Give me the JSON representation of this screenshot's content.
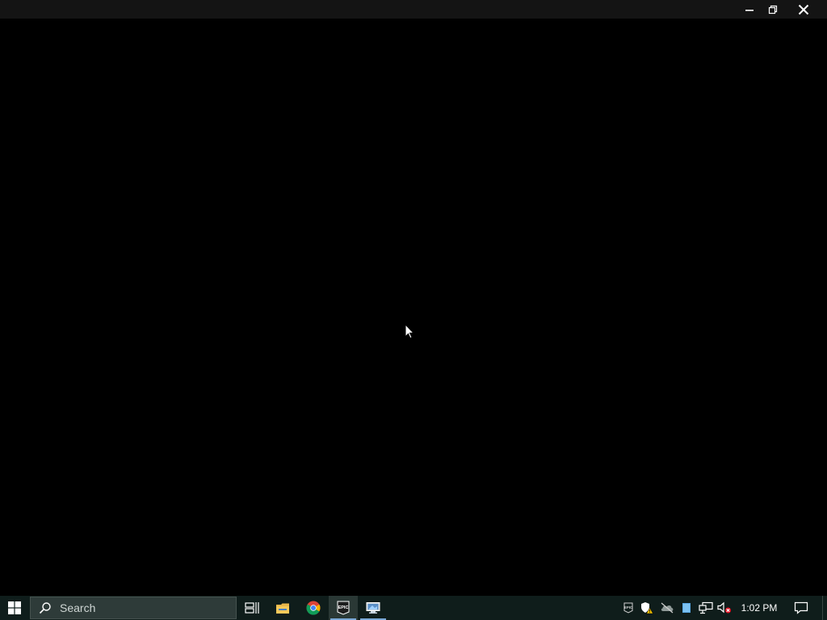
{
  "window": {
    "title": "",
    "buttons": [
      "minimize",
      "maximize",
      "close"
    ]
  },
  "taskbar": {
    "search_placeholder": "Search",
    "pinned_apps": [
      "task-view",
      "file-explorer",
      "google-chrome",
      "epic-games-launcher",
      "remote-desktop"
    ],
    "active_app": "epic-games-launcher",
    "tray_icons": [
      "epic-games-tray",
      "security-warning",
      "onedrive-offline",
      "notes",
      "network",
      "volume-muted"
    ],
    "clock": "1:02 PM"
  },
  "colors": {
    "background": "#000000",
    "titlebar": "#141414",
    "taskbar": "#0f1d1b",
    "search_box": "#2e3b39",
    "accent_underline": "#7aa8d6"
  }
}
